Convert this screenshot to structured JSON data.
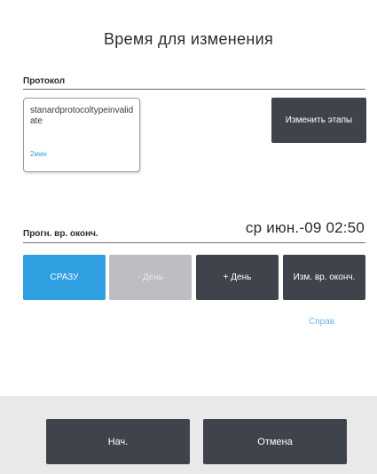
{
  "dialog": {
    "title": "Время для изменения"
  },
  "protocol_section": {
    "label": "Протокол",
    "card": {
      "name": "stanardprotocoltypeinvalidate",
      "duration": "2мин"
    },
    "edit_steps_button": "Изменить этапы"
  },
  "end_time_section": {
    "label": "Прогн. вр. оконч.",
    "value": "ср июн.-09 02:50",
    "buttons": {
      "now": "СРАЗУ",
      "minus_day": "- День",
      "plus_day": "+ День",
      "change_end": "Изм. вр. оконч."
    },
    "help_link": "Справ"
  },
  "footer": {
    "start_button": "Нач.",
    "cancel_button": "Отмена"
  },
  "colors": {
    "accent_blue": "#2f9fe2",
    "dark_button": "#3f434c",
    "disabled_button": "#bdbec3",
    "footer_bg": "#e9e9ea",
    "link": "#6db6e8"
  }
}
